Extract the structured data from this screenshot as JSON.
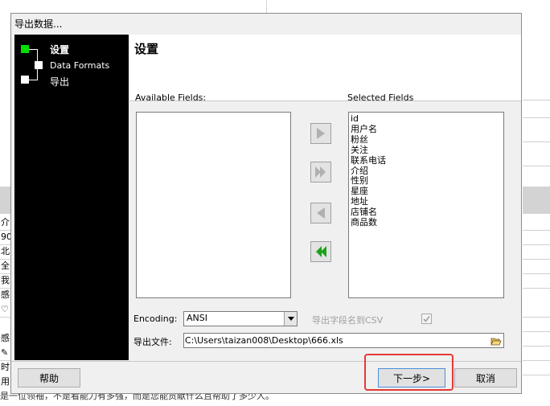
{
  "background": {
    "left_rows": [
      "介",
      "90",
      "北",
      "全",
      "我",
      "感",
      "♡",
      "",
      "感",
      "✎",
      "时",
      "用"
    ],
    "bottom_text": "是一位领袖，不是看能力有多强，而是您能贡献什么且帮助了多少人。"
  },
  "dialog": {
    "title": "导出数据...",
    "header_title": "设置"
  },
  "nav": {
    "steps": [
      {
        "label": "设置",
        "active": true
      },
      {
        "label": "Data Formats",
        "active": false
      },
      {
        "label": "导出",
        "active": false
      }
    ]
  },
  "fields": {
    "available_label": "Available Fields:",
    "selected_label": "Selected Fields",
    "available_items": [],
    "selected_items": [
      "id",
      "用户名",
      "粉丝",
      "关注",
      "联系电话",
      "介绍",
      "性别",
      "星座",
      "地址",
      "店铺名",
      "商品数"
    ]
  },
  "encoding": {
    "label": "Encoding:",
    "value": "ANSI"
  },
  "export_field_names": {
    "label": "导出字段名到CSV",
    "checked": true,
    "enabled": false
  },
  "export_file": {
    "label": "导出文件:",
    "value": "C:\\Users\\taizan008\\Desktop\\666.xls"
  },
  "buttons": {
    "help": "帮助",
    "next": "下一步>",
    "cancel": "取消"
  },
  "colors": {
    "nav_bg": "#000000",
    "active_step": "#00e000",
    "highlight": "#e53935",
    "arrow_disabled": "#b0b0b0",
    "arrow_enabled": "#1aa31a"
  }
}
